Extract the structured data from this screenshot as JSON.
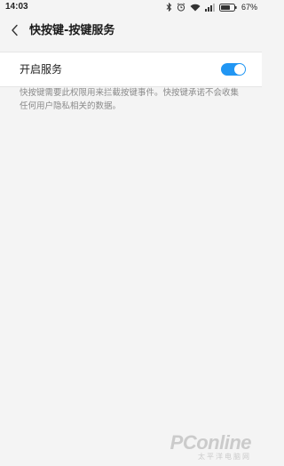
{
  "status_bar": {
    "time": "14:03",
    "battery_percent": "67%",
    "icons": [
      "bluetooth-icon",
      "alarm-icon",
      "wifi-icon",
      "signal-icon",
      "battery-icon"
    ]
  },
  "header": {
    "back_icon": "chevron-left-icon",
    "title": "快按键-按键服务"
  },
  "setting": {
    "label": "开启服务",
    "toggle_on": true,
    "accent_color": "#2196f3"
  },
  "description": "快按键需要此权限用来拦截按键事件。快按键承诺不会收集任何用户隐私相关的数据。",
  "watermark": {
    "logo": "PConline",
    "subtitle": "太平洋电脑网"
  }
}
